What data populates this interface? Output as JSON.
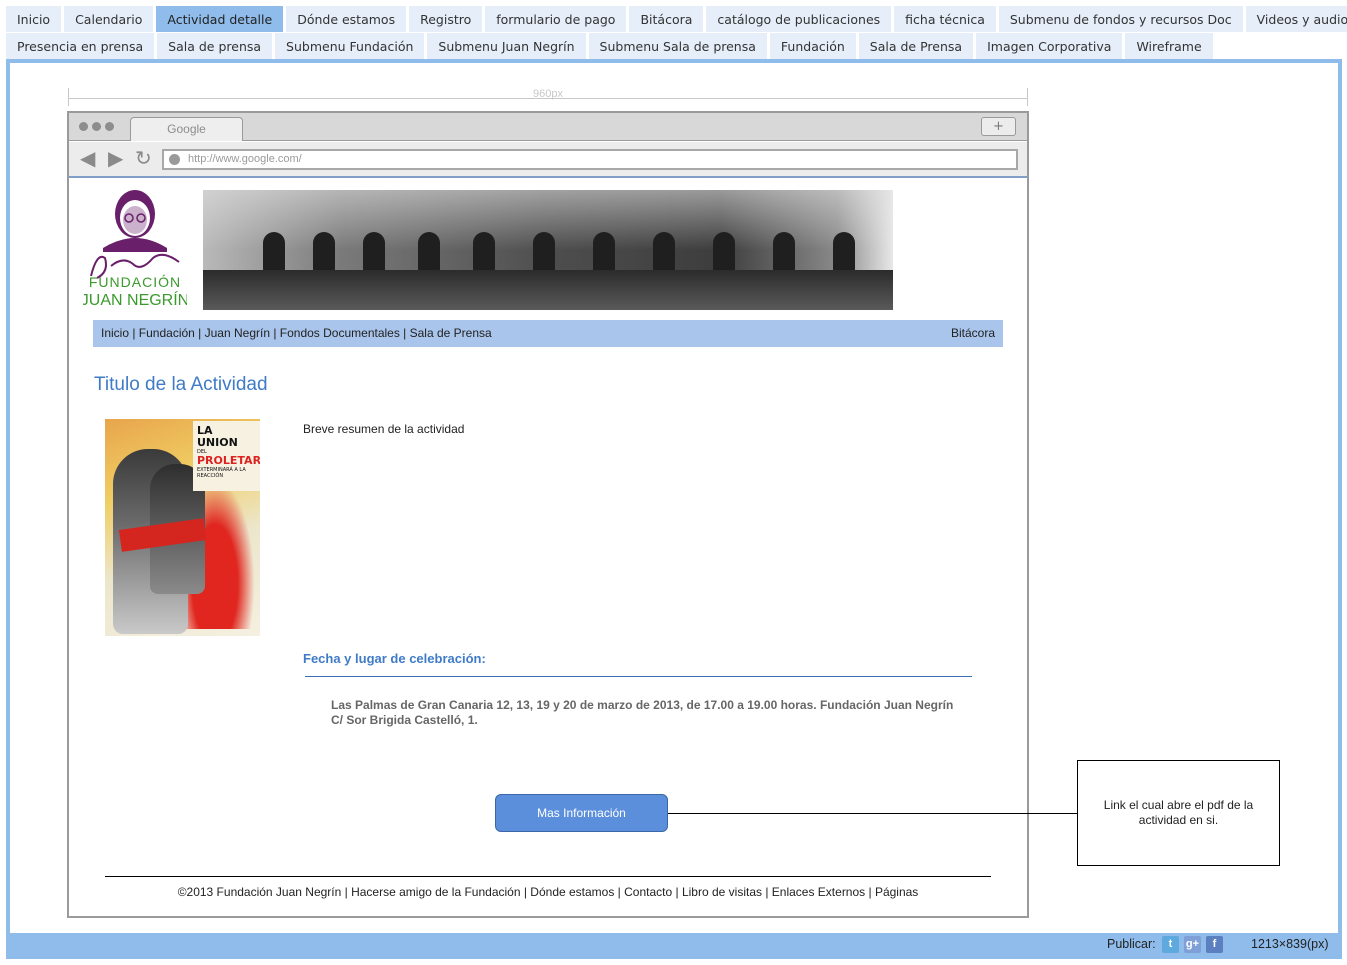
{
  "tabs_row1": [
    {
      "label": "Inicio",
      "active": false
    },
    {
      "label": "Calendario",
      "active": false
    },
    {
      "label": "Actividad detalle",
      "active": true
    },
    {
      "label": "Dónde estamos",
      "active": false
    },
    {
      "label": "Registro",
      "active": false
    },
    {
      "label": "formulario de pago",
      "active": false
    },
    {
      "label": "Bitácora",
      "active": false
    },
    {
      "label": "catálogo de publicaciones",
      "active": false
    },
    {
      "label": "ficha técnica",
      "active": false
    },
    {
      "label": "Submenu de fondos y recursos Doc",
      "active": false
    },
    {
      "label": "Videos y audios",
      "active": false
    }
  ],
  "tabs_row2": [
    {
      "label": "Presencia en prensa"
    },
    {
      "label": "Sala de prensa"
    },
    {
      "label": "Submenu Fundación"
    },
    {
      "label": "Submenu Juan Negrín"
    },
    {
      "label": "Submenu Sala de prensa"
    },
    {
      "label": "Fundación"
    },
    {
      "label": "Sala de Prensa"
    },
    {
      "label": "Imagen Corporativa"
    },
    {
      "label": "Wireframe"
    }
  ],
  "ruler": {
    "label": "960px"
  },
  "browser": {
    "tab_title": "Google",
    "plus": "+",
    "url": "http://www.google.com/"
  },
  "site": {
    "logo": {
      "signature": "J. Negrín",
      "line1": "FUNDACIÓN",
      "line2": "JUAN NEGRÍN"
    },
    "nav_links": "Inicio | Fundación | Juan Negrín | Fondos Documentales | Sala de Prensa",
    "nav_right": "Bitácora",
    "title": "Titulo de la Actividad",
    "poster": {
      "line1": "LA UNION",
      "line2": "DEL",
      "line3": "PROLETARIO",
      "line4": "EXTERMINARÁ A LA REACCIÓN"
    },
    "summary": "Breve resumen de la actividad",
    "fecha_heading": "Fecha y lugar de celebración:",
    "fecha_text": "Las Palmas de Gran Canaria 12, 13, 19 y 20 de marzo de 2013, de 17.00 a 19.00 horas. Fundación Juan Negrín C/ Sor Brigida Castelló, 1.",
    "mas_button": "Mas Información",
    "footer": "©2013 Fundación Juan Negrín | Hacerse amigo de la Fundación | Dónde estamos | Contacto | Libro de visitas | Enlaces Externos | Páginas"
  },
  "annotation": "Link el cual abre el pdf de la actividad en si.",
  "bottom": {
    "publicar": "Publicar:",
    "social_icons": [
      "twitter-icon",
      "google-plus-icon",
      "facebook-icon"
    ],
    "size": "1213×839(px)"
  },
  "colors": {
    "tab": "#e6eef9",
    "tab_active": "#8fbcea",
    "accent": "#3f7bc6",
    "navbar": "#a9c5ec",
    "button": "#5b8fdc"
  }
}
